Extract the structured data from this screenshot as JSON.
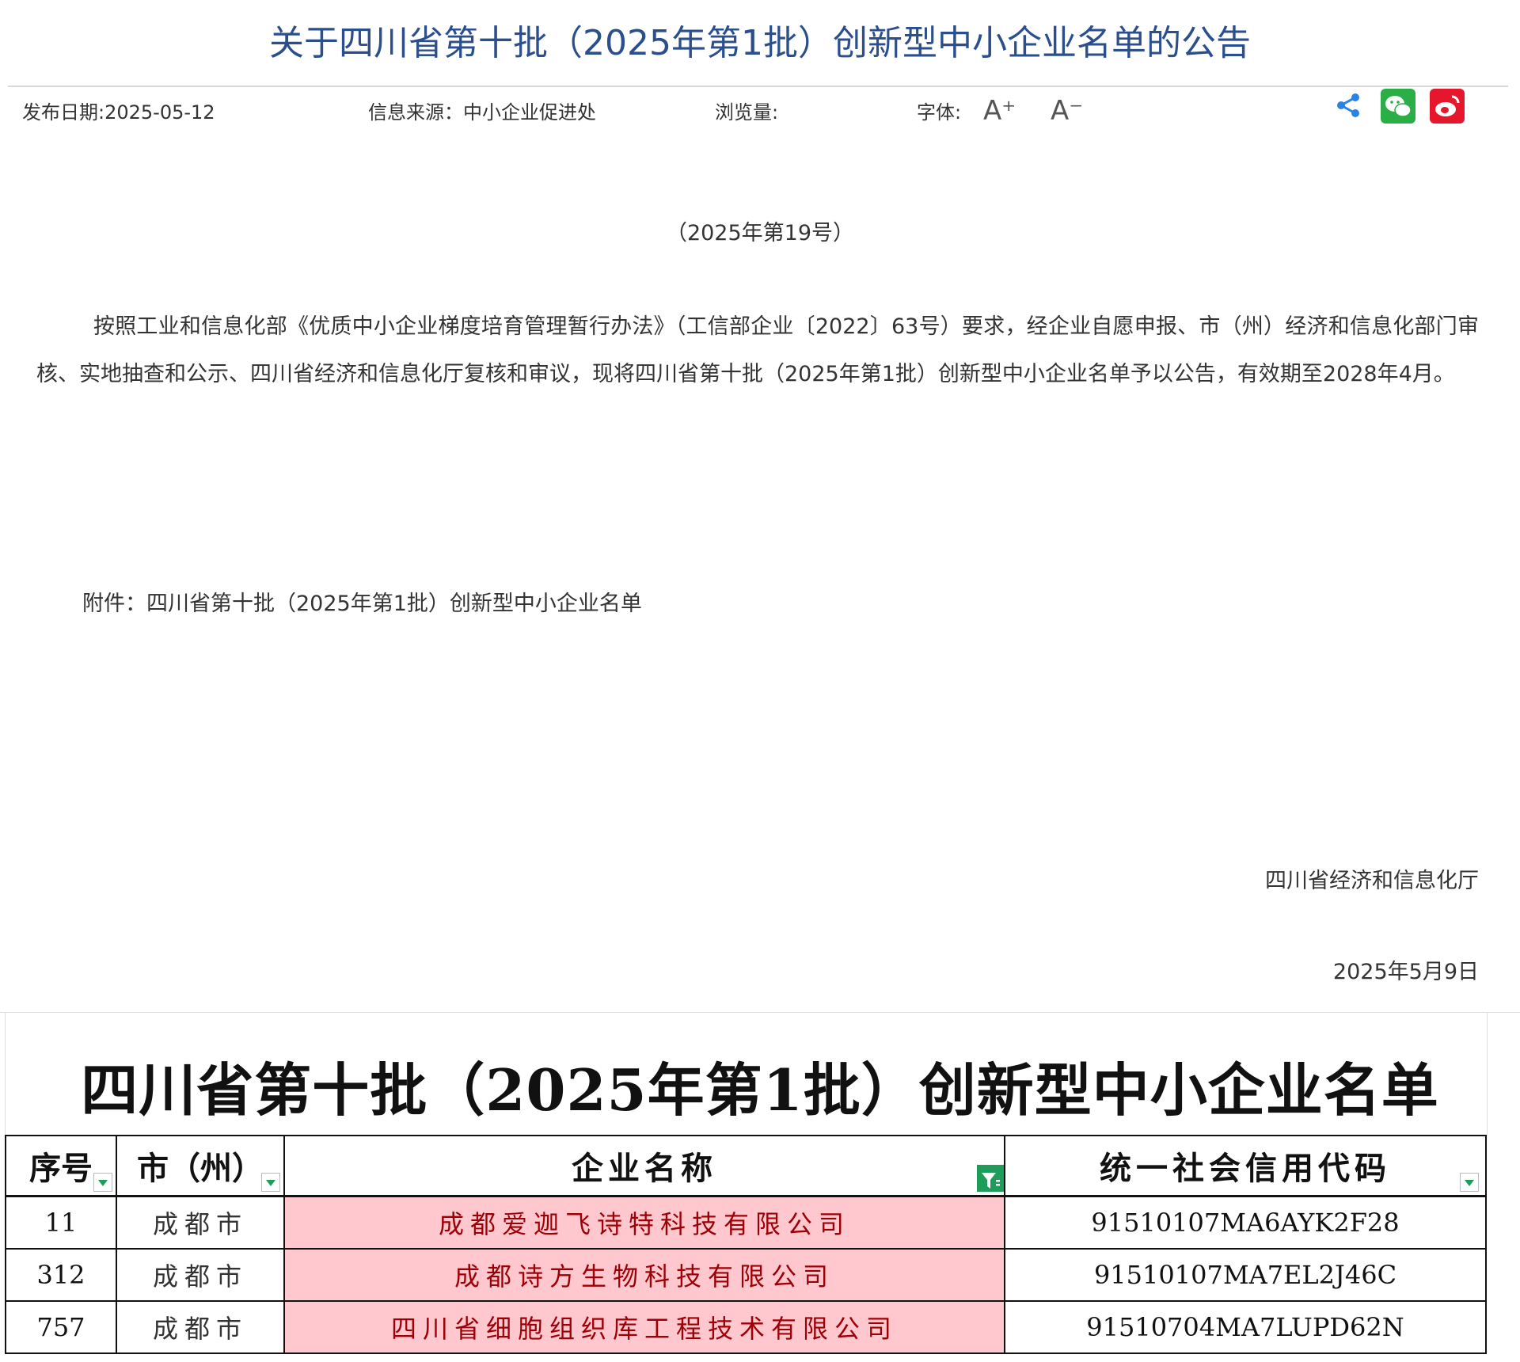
{
  "article": {
    "title": "关于四川省第十批（2025年第1批）创新型中小企业名单的公告",
    "meta": {
      "publish_date": "发布日期:2025-05-12",
      "source": "信息来源：中小企业促进处",
      "views": "浏览量:",
      "font_label": "字体:",
      "font_increase": "A⁺",
      "font_decrease": "A⁻"
    },
    "share_icons": [
      "share-icon",
      "wechat-icon",
      "weibo-icon"
    ],
    "doc_number": "（2025年第19号）",
    "body": "按照工业和信息化部《优质中小企业梯度培育管理暂行办法》（工信部企业〔2022〕63号）要求，经企业自愿申报、市（州）经济和信息化部门审核、实地抽查和公示、四川省经济和信息化厅复核和审议，现将四川省第十批（2025年第1批）创新型中小企业名单予以公告，有效期至2028年4月。",
    "attachment": "附件：四川省第十批（2025年第1批）创新型中小企业名单",
    "signature_org": "四川省经济和信息化厅",
    "signature_date": "2025年5月9日"
  },
  "spreadsheet": {
    "title": "四川省第十批（2025年第1批）创新型中小企业名单",
    "headers": [
      "序号",
      "市（州）",
      "企业名称",
      "统一社会信用代码"
    ],
    "rows": [
      {
        "index": "11",
        "city": "成都市",
        "name": "成都爱迦飞诗特科技有限公司",
        "code": "91510107MA6AYK2F28"
      },
      {
        "index": "312",
        "city": "成都市",
        "name": "成都诗方生物科技有限公司",
        "code": "91510107MA7EL2J46C"
      },
      {
        "index": "757",
        "city": "成都市",
        "name": "四川省细胞组织库工程技术有限公司",
        "code": "91510704MA7LUPD62N"
      }
    ],
    "colors": {
      "highlight_fill": "#ffc7ce",
      "highlight_text": "#9c0006",
      "filter_green": "#1e9d5a"
    }
  },
  "colors": {
    "title": "#2b4e8c",
    "wechat": "#2aae46",
    "weibo": "#e6162d",
    "share": "#2a82e4"
  }
}
